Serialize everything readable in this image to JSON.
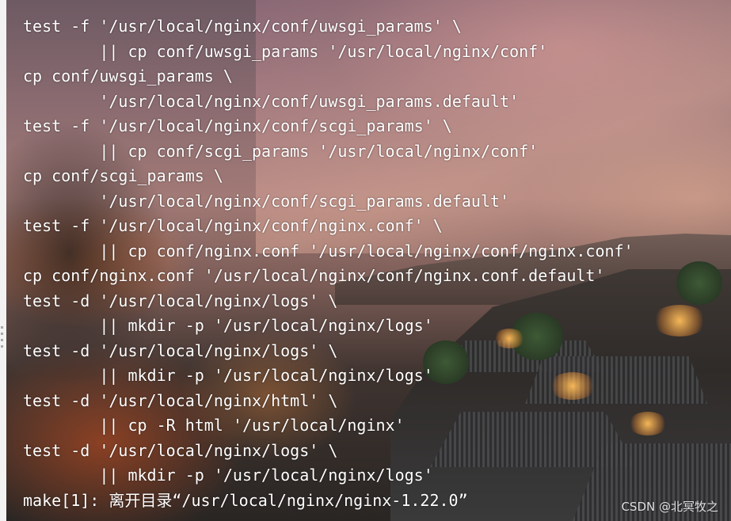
{
  "terminal": {
    "lines": [
      "test -f '/usr/local/nginx/conf/uwsgi_params' \\",
      "        || cp conf/uwsgi_params '/usr/local/nginx/conf'",
      "cp conf/uwsgi_params \\",
      "        '/usr/local/nginx/conf/uwsgi_params.default'",
      "test -f '/usr/local/nginx/conf/scgi_params' \\",
      "        || cp conf/scgi_params '/usr/local/nginx/conf'",
      "cp conf/scgi_params \\",
      "        '/usr/local/nginx/conf/scgi_params.default'",
      "test -f '/usr/local/nginx/conf/nginx.conf' \\",
      "        || cp conf/nginx.conf '/usr/local/nginx/conf/nginx.conf'",
      "cp conf/nginx.conf '/usr/local/nginx/conf/nginx.conf.default'",
      "test -d '/usr/local/nginx/logs' \\",
      "        || mkdir -p '/usr/local/nginx/logs'",
      "test -d '/usr/local/nginx/logs' \\",
      "        || mkdir -p '/usr/local/nginx/logs'",
      "test -d '/usr/local/nginx/html' \\",
      "        || cp -R html '/usr/local/nginx'",
      "test -d '/usr/local/nginx/logs' \\",
      "        || mkdir -p '/usr/local/nginx/logs'",
      "make[1]: 离开目录“/usr/local/nginx/nginx-1.22.0”"
    ]
  },
  "watermark": "CSDN @北冥牧之",
  "colors": {
    "text": "#ffffff",
    "left_border": "#f2f2f2"
  }
}
